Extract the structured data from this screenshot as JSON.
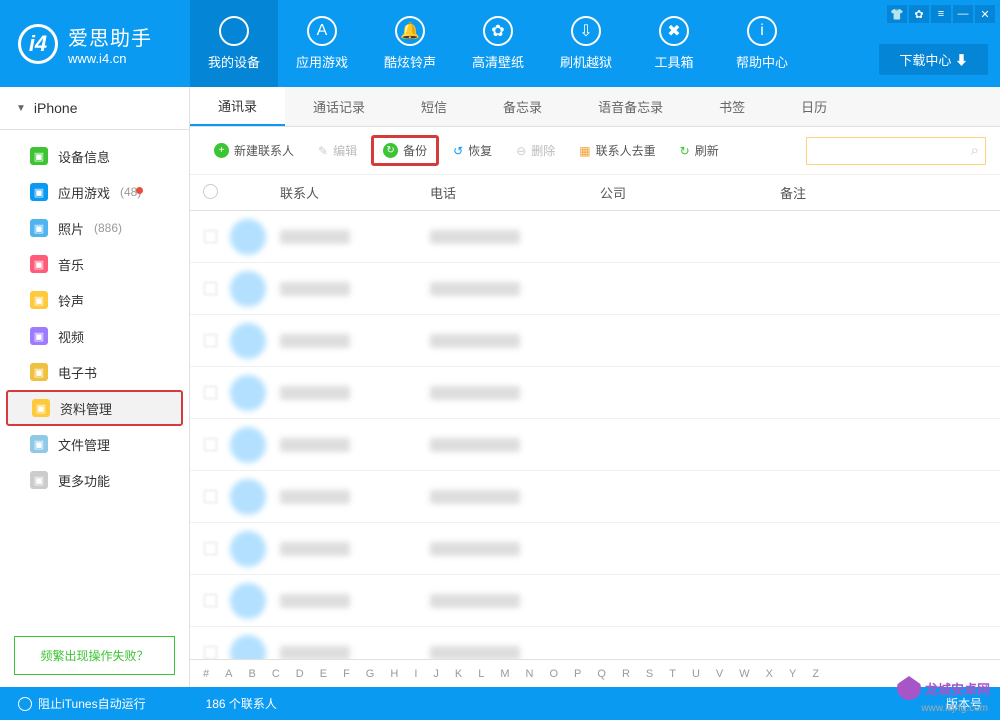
{
  "logo": {
    "title": "爱思助手",
    "subtitle": "www.i4.cn"
  },
  "nav_tabs": [
    {
      "label": "我的设备",
      "icon": ""
    },
    {
      "label": "应用游戏",
      "icon": "A"
    },
    {
      "label": "酷炫铃声",
      "icon": "🔔"
    },
    {
      "label": "高清壁纸",
      "icon": "✿"
    },
    {
      "label": "刷机越狱",
      "icon": "⇩"
    },
    {
      "label": "工具箱",
      "icon": "✖"
    },
    {
      "label": "帮助中心",
      "icon": "i"
    }
  ],
  "download_center": "下载中心 ⬇",
  "device_name": "iPhone",
  "sidebar": {
    "items": [
      {
        "label": "设备信息",
        "color": "#3cc434"
      },
      {
        "label": "应用游戏",
        "count": "(48)",
        "color": "#0a9af2",
        "dot": true
      },
      {
        "label": "照片",
        "count": "(886)",
        "color": "#4fb4f0"
      },
      {
        "label": "音乐",
        "color": "#ff5c7a"
      },
      {
        "label": "铃声",
        "color": "#ffc93c"
      },
      {
        "label": "视频",
        "color": "#9e7bff"
      },
      {
        "label": "电子书",
        "color": "#f0c040"
      },
      {
        "label": "资料管理",
        "color": "#ffc93c",
        "highlight": true
      },
      {
        "label": "文件管理",
        "color": "#8fc9e8"
      },
      {
        "label": "更多功能",
        "color": "#ccc"
      }
    ],
    "help": "频繁出现操作失败？"
  },
  "sub_tabs": [
    "通讯录",
    "通话记录",
    "短信",
    "备忘录",
    "语音备忘录",
    "书签",
    "日历"
  ],
  "toolbar": {
    "new_contact": "新建联系人",
    "edit": "编辑",
    "backup": "备份",
    "restore": "恢复",
    "delete": "删除",
    "dedup": "联系人去重",
    "refresh": "刷新"
  },
  "table": {
    "headers": {
      "contact": "联系人",
      "phone": "电话",
      "company": "公司",
      "note": "备注"
    }
  },
  "alpha": [
    "#",
    "A",
    "B",
    "C",
    "D",
    "E",
    "F",
    "G",
    "H",
    "I",
    "J",
    "K",
    "L",
    "M",
    "N",
    "O",
    "P",
    "Q",
    "R",
    "S",
    "T",
    "U",
    "V",
    "W",
    "X",
    "Y",
    "Z"
  ],
  "footer": {
    "itunes": "阻止iTunes自动运行",
    "count": "186 个联系人",
    "version": "版本号"
  },
  "watermark": {
    "text": "龙城安卓网",
    "sub": "www.lcjrfg.com"
  }
}
